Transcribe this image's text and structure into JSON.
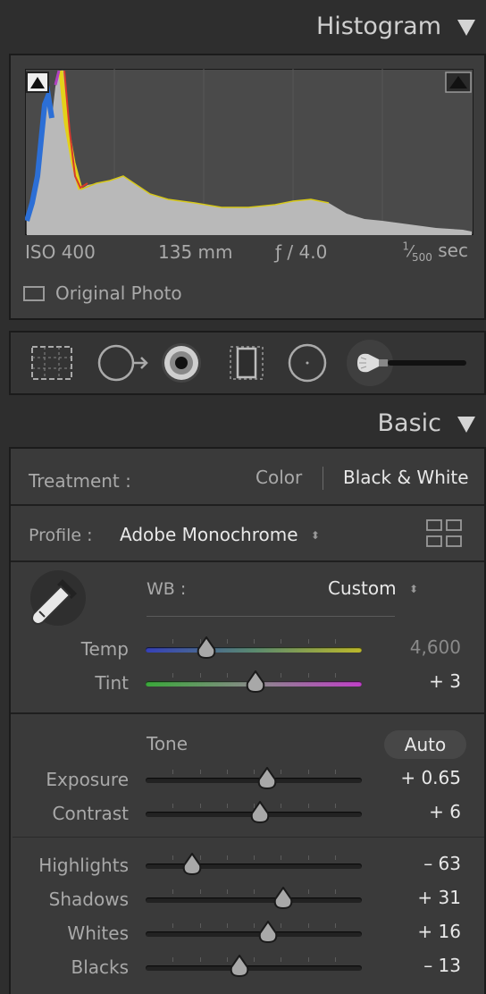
{
  "histogram": {
    "title": "Histogram",
    "meta": {
      "iso": "ISO 400",
      "focal": "135 mm",
      "aperture": "ƒ / 4.0",
      "shutter_num": "1",
      "shutter_den": "500",
      "shutter_unit": "sec"
    },
    "original_photo_label": "Original Photo"
  },
  "tools": [
    "crop-icon",
    "healing-icon",
    "red-eye-icon",
    "masking-icon",
    "radial-icon",
    "brush-icon"
  ],
  "basic": {
    "title": "Basic",
    "treatment_label": "Treatment :",
    "treatment_options": [
      "Color",
      "Black & White"
    ],
    "treatment_selected": "Black & White",
    "profile_label": "Profile :",
    "profile_value": "Adobe Monochrome",
    "wb_label": "WB :",
    "wb_value": "Custom",
    "tone_label": "Tone",
    "auto_label": "Auto",
    "sliders": [
      {
        "id": "temp",
        "label": "Temp",
        "value": "4,600",
        "pos": 0.28,
        "style": "temp",
        "dim": true
      },
      {
        "id": "tint",
        "label": "Tint",
        "value": "+ 3",
        "pos": 0.51,
        "style": "tint"
      },
      {
        "id": "exposure",
        "label": "Exposure",
        "value": "+ 0.65",
        "pos": 0.56,
        "style": "tone"
      },
      {
        "id": "contrast",
        "label": "Contrast",
        "value": "+ 6",
        "pos": 0.53,
        "style": "tone"
      },
      {
        "id": "highlights",
        "label": "Highlights",
        "value": "– 63",
        "pos": 0.215,
        "style": "tone"
      },
      {
        "id": "shadows",
        "label": "Shadows",
        "value": "+ 31",
        "pos": 0.635,
        "style": "tone"
      },
      {
        "id": "whites",
        "label": "Whites",
        "value": "+ 16",
        "pos": 0.565,
        "style": "tone"
      },
      {
        "id": "blacks",
        "label": "Blacks",
        "value": "– 13",
        "pos": 0.435,
        "style": "tone"
      }
    ]
  },
  "colors": {
    "bg": "#2e2e2e",
    "panel": "#3a3a3a",
    "border": "#1b1b1b"
  }
}
